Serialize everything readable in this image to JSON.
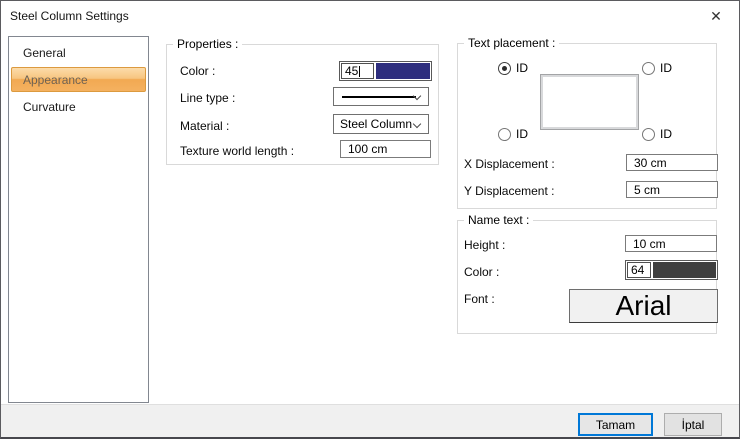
{
  "window": {
    "title": "Steel Column Settings",
    "close_glyph": "✕"
  },
  "sidebar": {
    "items": [
      {
        "label": "General",
        "selected": false
      },
      {
        "label": "Appearance",
        "selected": true
      },
      {
        "label": "Curvature",
        "selected": false
      }
    ]
  },
  "properties": {
    "legend": "Properties :",
    "color": {
      "label": "Color :",
      "value": "45",
      "swatch_hex": "#2e2e7e"
    },
    "line_type": {
      "label": "Line type :"
    },
    "material": {
      "label": "Material :",
      "value": "Steel Column"
    },
    "texture": {
      "label": "Texture world length :",
      "value": "100 cm"
    }
  },
  "text_placement": {
    "legend": "Text placement :",
    "radios": [
      {
        "position": "top-left",
        "label": "ID",
        "selected": true
      },
      {
        "position": "top-right",
        "label": "ID",
        "selected": false
      },
      {
        "position": "bottom-left",
        "label": "ID",
        "selected": false
      },
      {
        "position": "bottom-right",
        "label": "ID",
        "selected": false
      }
    ],
    "x_displacement": {
      "label": "X Displacement :",
      "value": "30 cm"
    },
    "y_displacement": {
      "label": "Y Displacement :",
      "value": "5 cm"
    }
  },
  "name_text": {
    "legend": "Name text :",
    "height": {
      "label": "Height :",
      "value": "10 cm"
    },
    "color": {
      "label": "Color :",
      "value": "64",
      "swatch_hex": "#3f3f3f"
    },
    "font": {
      "label": "Font :",
      "value": "Arial"
    }
  },
  "footer": {
    "ok_label": "Tamam",
    "cancel_label": "İptal"
  },
  "colors": {
    "selected_item_accent": "#f2a952",
    "default_button_border": "#0078d7"
  }
}
